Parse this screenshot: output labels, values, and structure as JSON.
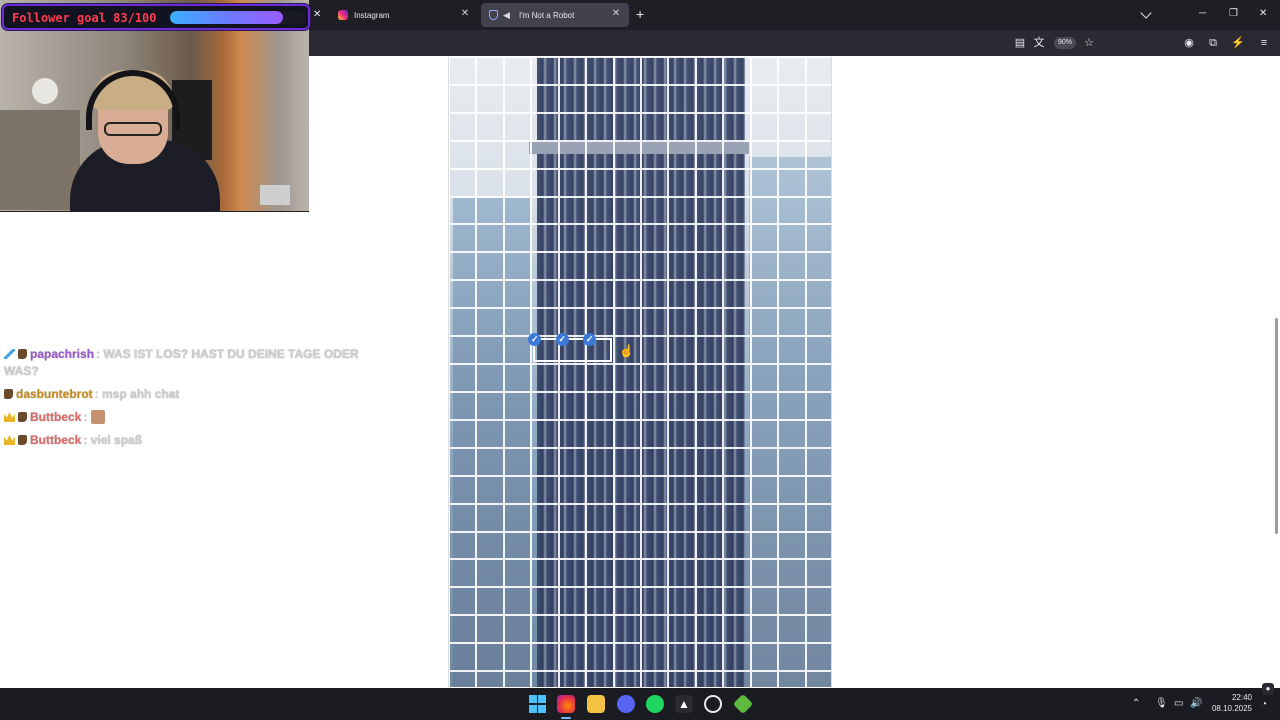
{
  "overlay": {
    "follower_goal": "Follower goal 83/100",
    "follower_progress": 0.83
  },
  "tabs": [
    {
      "label": "Instagram",
      "active": false
    },
    {
      "label": "I'm Not a Robot",
      "active": true
    }
  ],
  "toolbar": {
    "zoom": "90%"
  },
  "chat": [
    {
      "badges": [
        "sword",
        "boot"
      ],
      "user": "papachrish",
      "user_color": "#9b59d0",
      "message": "WAS IST LOS? HAST DU DEINE TAGE ODER WAS?"
    },
    {
      "badges": [
        "boot"
      ],
      "user": "dasbuntebrot",
      "user_color": "#c98f1e",
      "message": "msp ahh chat"
    },
    {
      "badges": [
        "crown",
        "boot"
      ],
      "user": "Buttbeck",
      "user_color": "#e06a6a",
      "message": "",
      "emote": true
    },
    {
      "badges": [
        "crown",
        "boot"
      ],
      "user": "Buttbeck",
      "user_color": "#e06a6a",
      "message": "viel spaß"
    }
  ],
  "captcha": {
    "columns": 14,
    "rows": 23,
    "selected": [
      {
        "row": 10,
        "col": 3
      },
      {
        "row": 10,
        "col": 4
      },
      {
        "row": 10,
        "col": 5
      }
    ]
  },
  "taskbar": {
    "time": "22:40",
    "date": "08.10.2025"
  }
}
